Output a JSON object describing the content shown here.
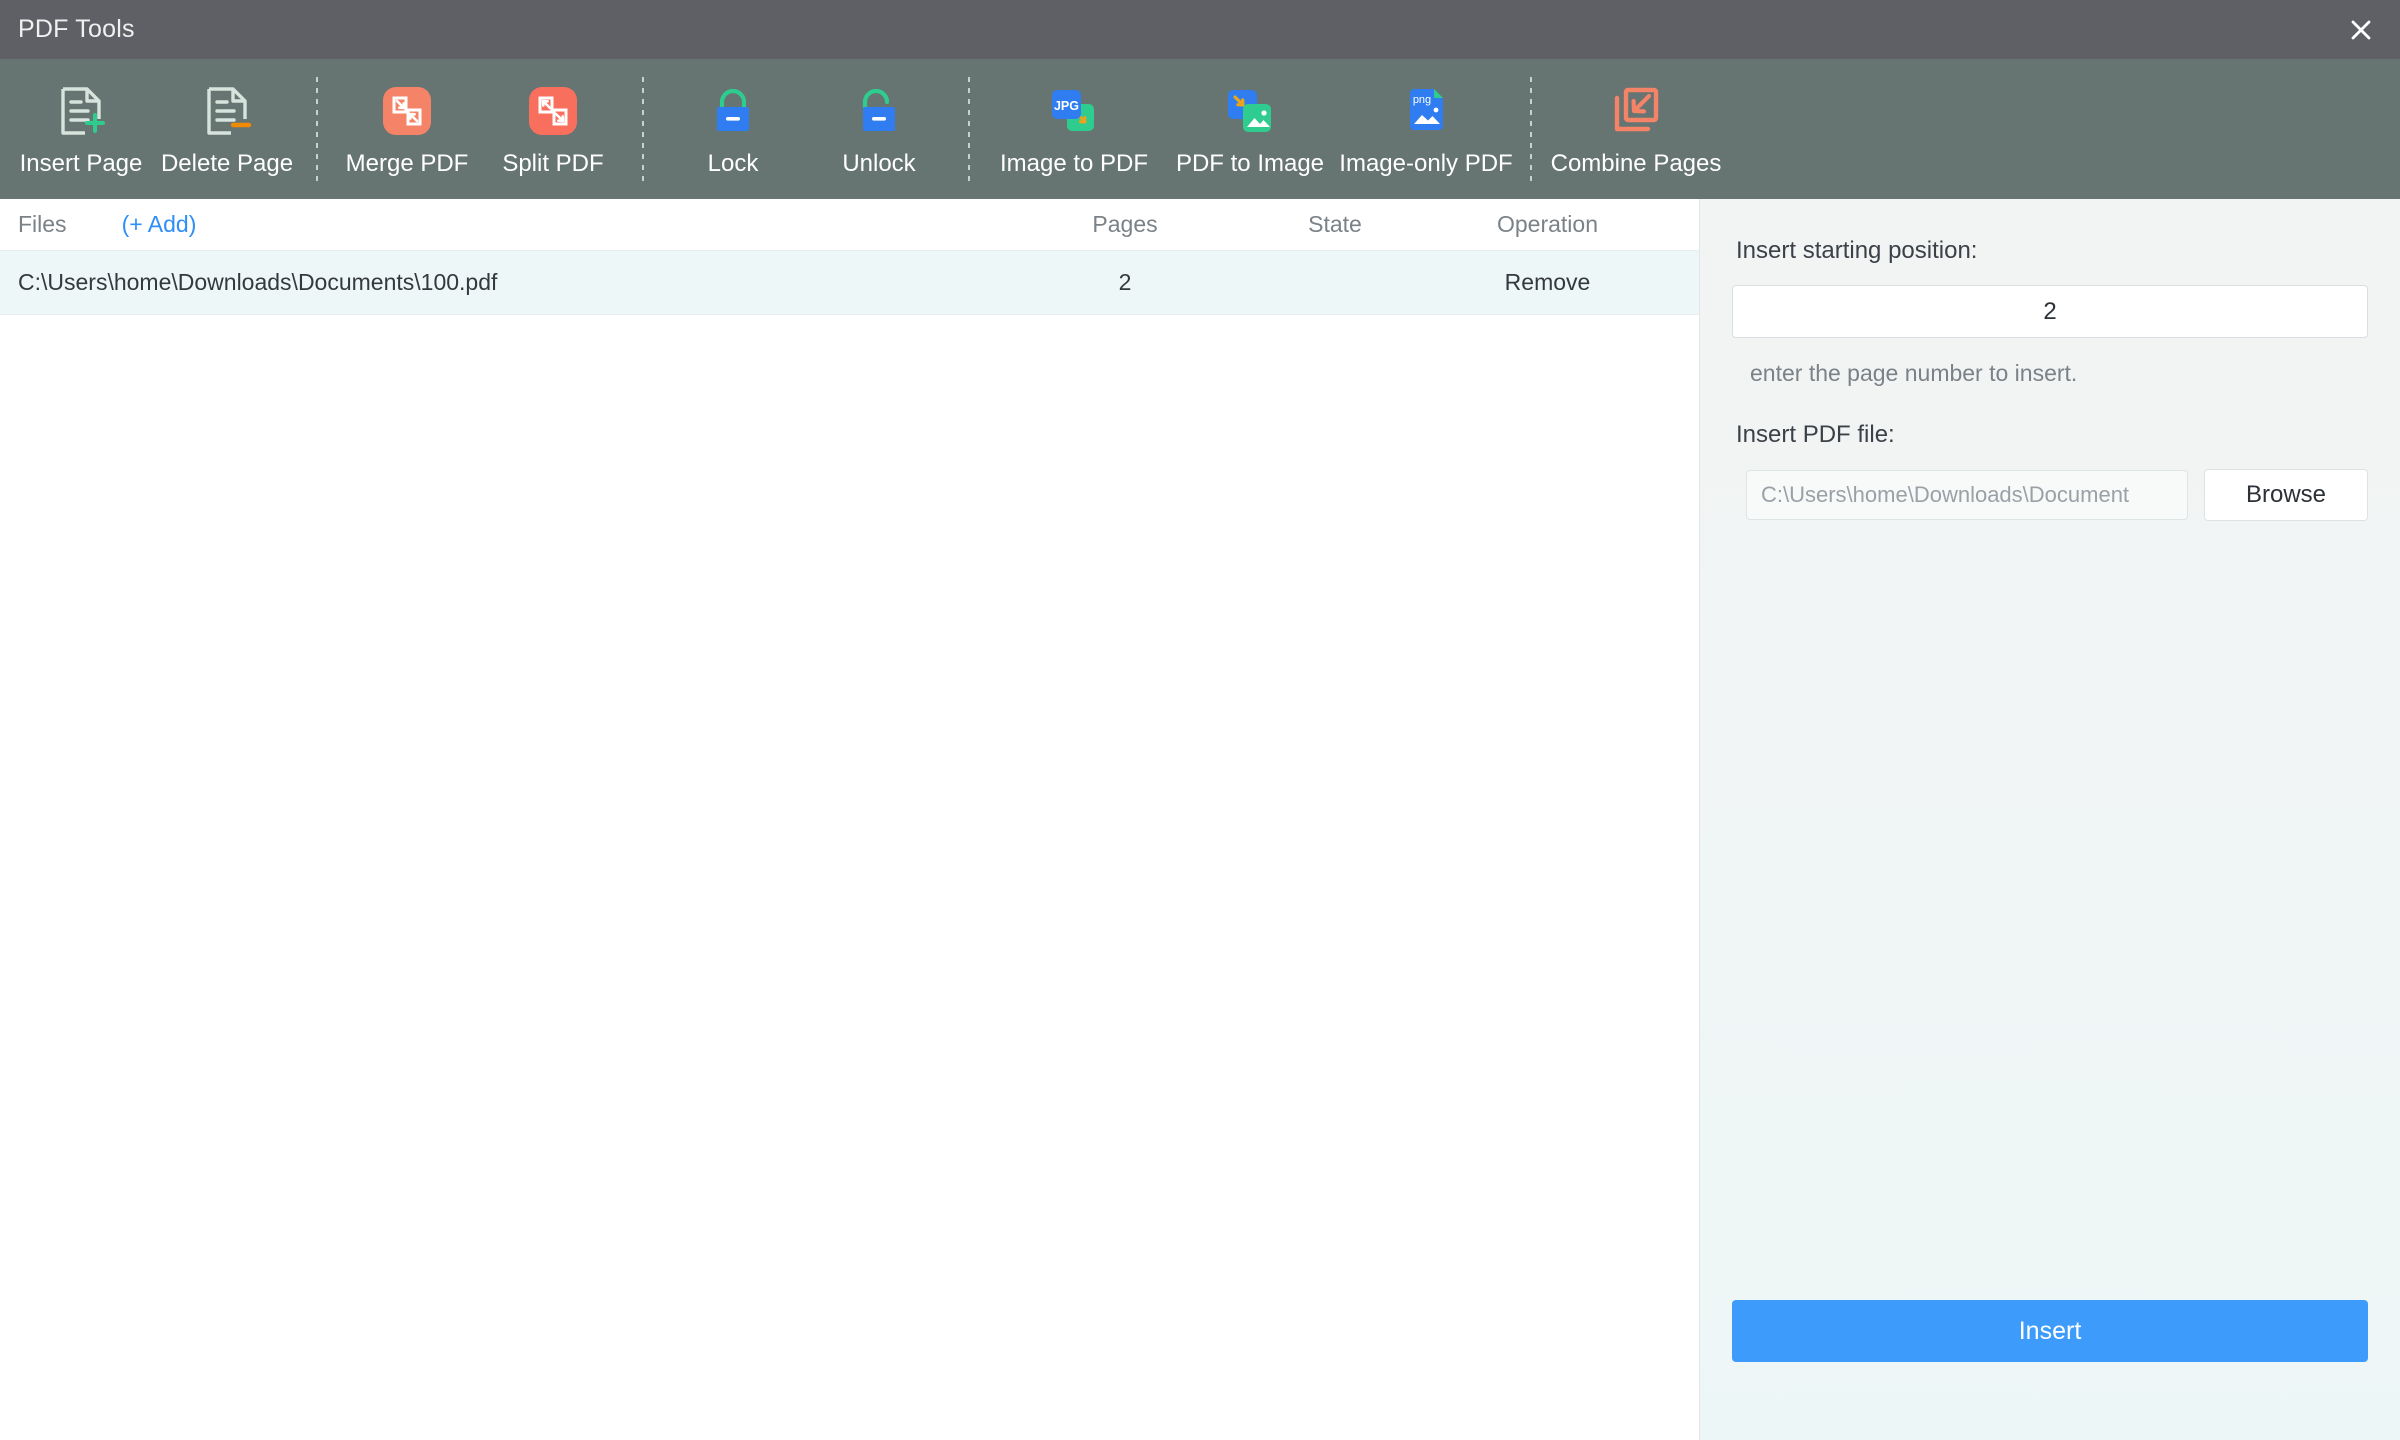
{
  "window": {
    "title": "PDF Tools",
    "close_icon": "close-icon"
  },
  "toolbar": {
    "tools": [
      {
        "id": "insert-page",
        "label": "Insert Page",
        "icon": "document-plus-icon"
      },
      {
        "id": "delete-page",
        "label": "Delete Page",
        "icon": "document-minus-icon"
      },
      {
        "id": "merge-pdf",
        "label": "Merge PDF",
        "icon": "merge-icon"
      },
      {
        "id": "split-pdf",
        "label": "Split PDF",
        "icon": "split-icon"
      },
      {
        "id": "lock",
        "label": "Lock",
        "icon": "lock-closed-icon"
      },
      {
        "id": "unlock",
        "label": "Unlock",
        "icon": "lock-open-icon"
      },
      {
        "id": "image-to-pdf",
        "label": "Image to PDF",
        "icon": "jpg-to-pdf-icon"
      },
      {
        "id": "pdf-to-image",
        "label": "PDF to Image",
        "icon": "pdf-to-image-icon"
      },
      {
        "id": "image-only-pdf",
        "label": "Image-only PDF",
        "icon": "png-document-icon"
      },
      {
        "id": "combine-pages",
        "label": "Combine Pages",
        "icon": "combine-icon"
      }
    ],
    "badge_texts": {
      "jpg": "JPG",
      "png": "png"
    }
  },
  "file_table": {
    "headers": {
      "files": "Files",
      "add": "(+ Add)",
      "pages": "Pages",
      "state": "State",
      "operation": "Operation"
    },
    "rows": [
      {
        "path": "C:\\Users\\home\\Downloads\\Documents\\100.pdf",
        "pages": "2",
        "state": "",
        "operation": "Remove"
      }
    ]
  },
  "panel": {
    "position_label": "Insert starting position:",
    "position_value": "2",
    "position_help": "enter the page number to insert.",
    "file_label": "Insert PDF file:",
    "file_placeholder": "C:\\Users\\home\\Downloads\\Document",
    "file_value": "",
    "browse_label": "Browse",
    "submit_label": "Insert"
  },
  "colors": {
    "titlebar": "#5f6065",
    "toolbar": "#667472",
    "accent_blue": "#3d9bfb",
    "accent_link": "#2f8ef7",
    "accent_coral": "#f58368",
    "accent_green": "#2ecc8f",
    "accent_orange": "#f08a00",
    "row_highlight": "#eef7f8"
  }
}
